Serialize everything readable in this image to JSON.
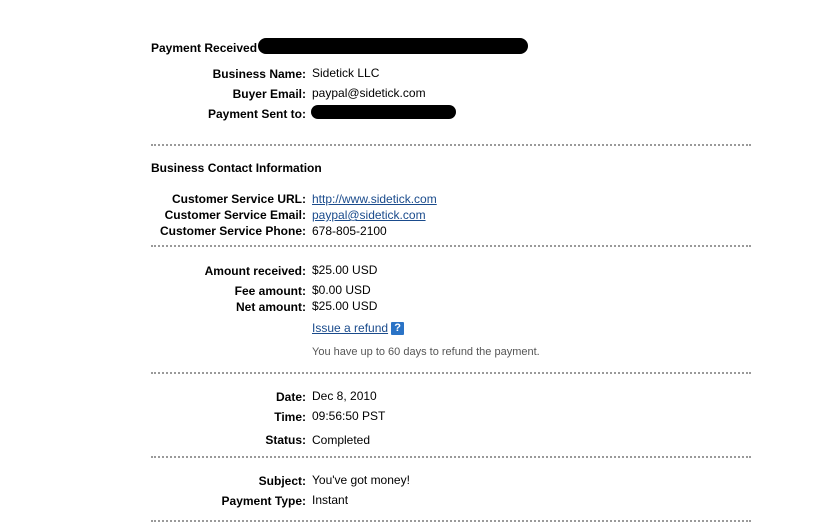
{
  "payment_header": {
    "title": "Payment Received"
  },
  "payment_info": {
    "business_name_label": "Business Name:",
    "business_name_value": "Sidetick LLC",
    "buyer_email_label": "Buyer Email:",
    "buyer_email_value": "paypal@sidetick.com",
    "payment_sent_to_label": "Payment Sent to:"
  },
  "contact_info": {
    "title": "Business Contact Information",
    "url_label": "Customer Service URL:",
    "url_value": "http://www.sidetick.com",
    "email_label": "Customer Service Email:",
    "email_value": "paypal@sidetick.com",
    "phone_label": "Customer Service Phone:",
    "phone_value": "678-805-2100"
  },
  "amounts": {
    "received_label": "Amount received:",
    "received_value": "$25.00 USD",
    "fee_label": "Fee amount:",
    "fee_value": "$0.00 USD",
    "net_label": "Net amount:",
    "net_value": "$25.00 USD",
    "refund_link": "Issue a refund",
    "help_icon_glyph": "?",
    "refund_note": "You have up to 60 days to refund the payment."
  },
  "details": {
    "date_label": "Date:",
    "date_value": "Dec 8, 2010",
    "time_label": "Time:",
    "time_value": "09:56:50 PST",
    "status_label": "Status:",
    "status_value": "Completed"
  },
  "message": {
    "subject_label": "Subject:",
    "subject_value": "You've got money!",
    "payment_type_label": "Payment Type:",
    "payment_type_value": "Instant"
  },
  "colors": {
    "link": "#1a4b8c",
    "divider": "#9a9a9a",
    "help_icon": "#2a73c6",
    "note_text": "#555555"
  },
  "icons": {
    "help": "help-question-icon"
  }
}
